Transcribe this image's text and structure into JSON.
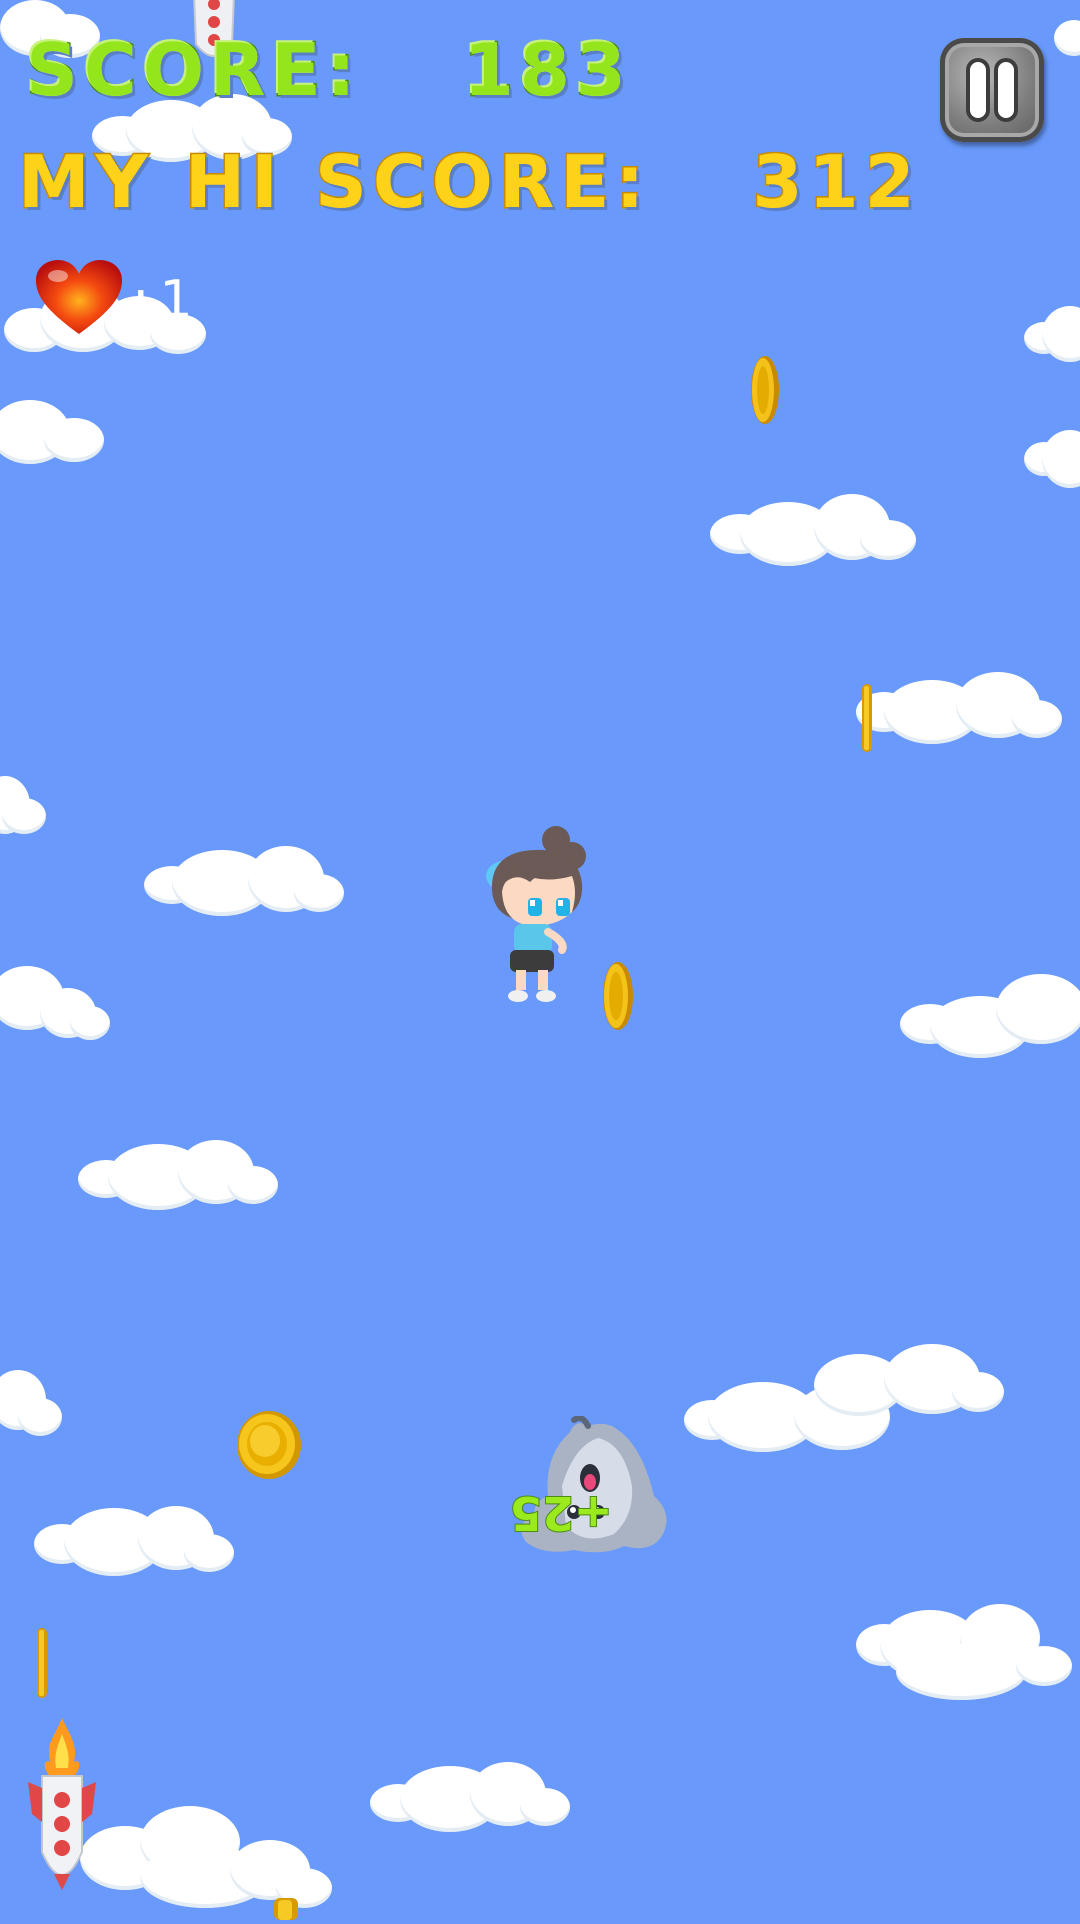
{
  "hud": {
    "score_label": "SCORE:",
    "score_value": "183",
    "hiscore_label": "MY HI SCORE:",
    "hiscore_value": "312",
    "lives_separator": ":",
    "lives_count": "1"
  },
  "effects": {
    "floating_points": "+25"
  },
  "colors": {
    "sky": "#6899fb",
    "score_text": "#94e51b",
    "hiscore_text": "#ffd21a",
    "coin": "#f5c518"
  },
  "icons": [
    "heart-icon",
    "pause-icon",
    "coin-icon",
    "rocket-icon",
    "player-character",
    "ghost-enemy"
  ]
}
